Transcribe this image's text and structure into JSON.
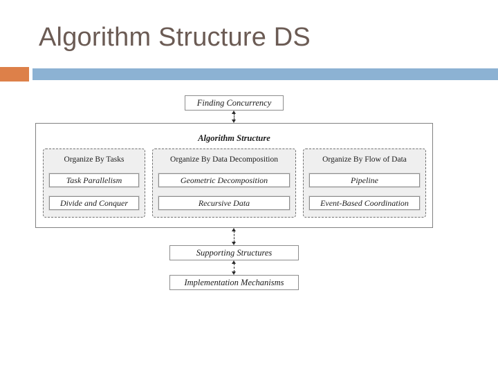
{
  "slide": {
    "title": "Algorithm Structure DS",
    "accent_orange": "#dd8049",
    "accent_blue": "#8cb2d3",
    "title_color": "#6b5b54",
    "background": "#ffffff"
  },
  "diagram": {
    "type": "flow-diagram",
    "top_node": {
      "label": "Finding Concurrency"
    },
    "container": {
      "label": "Algorithm Structure",
      "groups": [
        {
          "title": "Organize By Tasks",
          "patterns": [
            "Task Parallelism",
            "Divide and Conquer"
          ]
        },
        {
          "title": "Organize By Data Decomposition",
          "patterns": [
            "Geometric Decomposition",
            "Recursive Data"
          ]
        },
        {
          "title": "Organize By Flow of Data",
          "patterns": [
            "Pipeline",
            "Event-Based Coordination"
          ]
        }
      ]
    },
    "bottom_nodes": [
      {
        "label": "Supporting Structures"
      },
      {
        "label": "Implementation Mechanisms"
      }
    ],
    "connectors": [
      {
        "from": "Finding Concurrency",
        "to": "Algorithm Structure",
        "style": "dashed-double-arrow"
      },
      {
        "from": "Algorithm Structure",
        "to": "Supporting Structures",
        "style": "dashed-double-arrow"
      },
      {
        "from": "Supporting Structures",
        "to": "Implementation Mechanisms",
        "style": "dashed-double-arrow"
      }
    ],
    "colors": {
      "group_fill": "#efefef",
      "group_border": "#707070",
      "node_border": "#8c8c8c",
      "outer_border": "#808080"
    }
  }
}
